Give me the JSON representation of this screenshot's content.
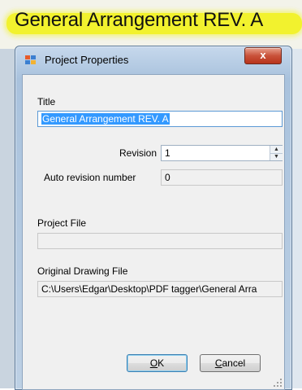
{
  "background": {
    "document_title": "General Arrangement REV. A"
  },
  "dialog": {
    "title": "Project Properties",
    "close_glyph": "x",
    "title_label": "Title",
    "title_value": "General Arrangement REV. A",
    "revision_label": "Revision",
    "revision_value": "1",
    "auto_revision_label": "Auto revision number",
    "auto_revision_value": "0",
    "project_file_label": "Project File",
    "project_file_value": "",
    "original_drawing_label": "Original Drawing File",
    "original_drawing_value": "C:\\Users\\Edgar\\Desktop\\PDF tagger\\General Arra",
    "ok_label": "OK",
    "ok_mnemonic": "O",
    "ok_rest": "K",
    "cancel_mnemonic": "C",
    "cancel_rest": "ancel"
  },
  "colors": {
    "highlight": "#f2f21a",
    "selection": "#3399ff",
    "close_button": "#c9523a"
  }
}
